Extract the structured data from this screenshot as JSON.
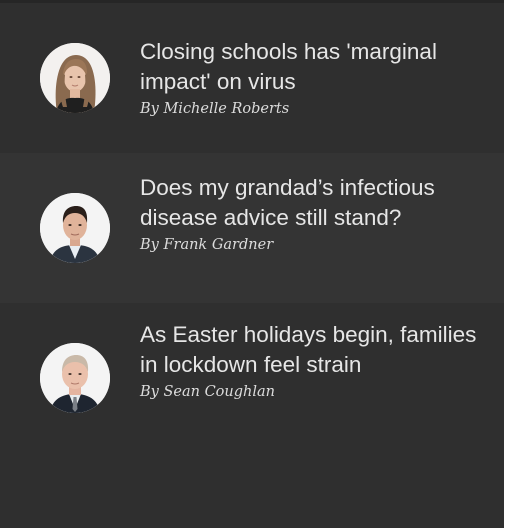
{
  "stories": [
    {
      "headline": "Closing schools has 'marginal impact' on virus",
      "byline": "By Michelle Roberts",
      "avatar_icon": "woman-portrait-avatar"
    },
    {
      "headline": "Does my grandad’s infectious disease advice still stand?",
      "byline": "By Frank Gardner",
      "avatar_icon": "man-portrait-avatar"
    },
    {
      "headline": "As Easter holidays begin, families in lockdown feel strain",
      "byline": "By Sean Coughlan",
      "avatar_icon": "man-portrait-avatar"
    }
  ],
  "colors": {
    "panel_background": "#2f2f2f",
    "highlight_row_background": "#343434",
    "headline_text": "#e6e6e6",
    "byline_text": "#dcdcdc",
    "avatar_background": "#f2f2f2"
  }
}
